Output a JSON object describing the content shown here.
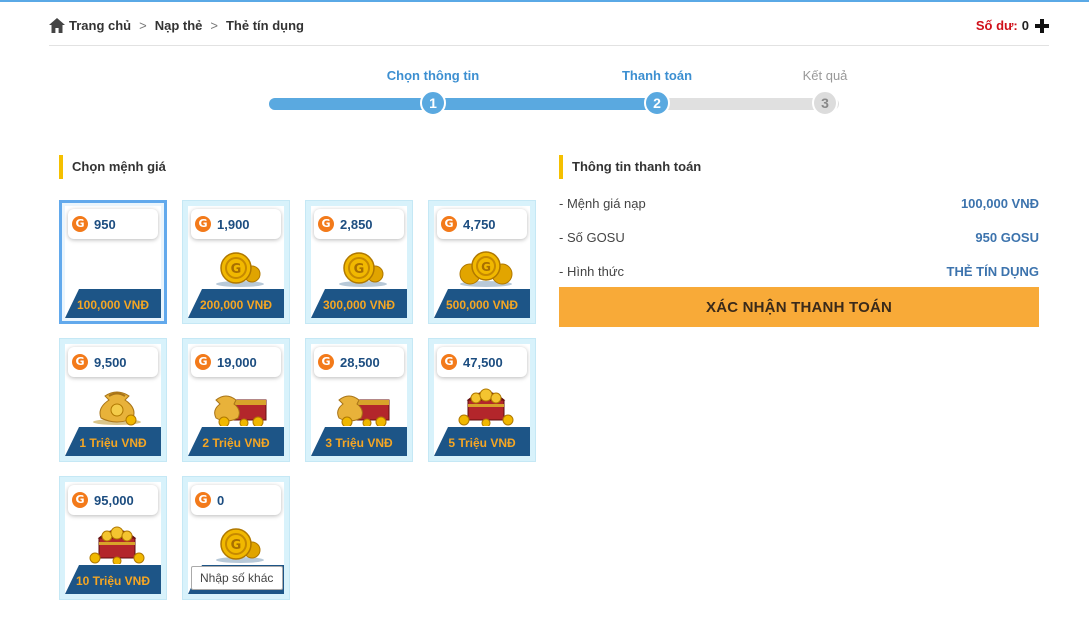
{
  "breadcrumb": {
    "items": [
      "Trang chủ",
      "Nạp thẻ",
      "Thẻ tín dụng"
    ],
    "separator": ">"
  },
  "balance": {
    "label": "Số dư:",
    "value": "0"
  },
  "stepper": {
    "steps": [
      {
        "label": "Chọn thông tin",
        "number": "1",
        "state": "done"
      },
      {
        "label": "Thanh toán",
        "number": "2",
        "state": "active"
      },
      {
        "label": "Kết quả",
        "number": "3",
        "state": "pending"
      }
    ],
    "progress_step": 2
  },
  "denominations": {
    "title": "Chọn mệnh giá",
    "selected_index": 0,
    "cards": [
      {
        "gosu": "950",
        "price": "100,000 VNĐ",
        "art": "none"
      },
      {
        "gosu": "1,900",
        "price": "200,000 VNĐ",
        "art": "coins-small"
      },
      {
        "gosu": "2,850",
        "price": "300,000 VNĐ",
        "art": "coins-small"
      },
      {
        "gosu": "4,750",
        "price": "500,000 VNĐ",
        "art": "coins-stack"
      },
      {
        "gosu": "9,500",
        "price": "1 Triệu VNĐ",
        "art": "gold-bag"
      },
      {
        "gosu": "19,000",
        "price": "2 Triệu VNĐ",
        "art": "bag-chest"
      },
      {
        "gosu": "28,500",
        "price": "3 Triệu VNĐ",
        "art": "bag-chest"
      },
      {
        "gosu": "47,500",
        "price": "5 Triệu VNĐ",
        "art": "treasure-chest"
      },
      {
        "gosu": "95,000",
        "price": "10 Triệu VNĐ",
        "art": "treasure-chest"
      }
    ],
    "custom": {
      "gosu": "0",
      "placeholder": "Nhập số khác",
      "art": "coins-small"
    }
  },
  "payment_info": {
    "title": "Thông tin thanh toán",
    "rows": [
      {
        "label": "- Mệnh giá nạp",
        "value": "100,000 VNĐ"
      },
      {
        "label": "- Số GOSU",
        "value": "950 GOSU"
      },
      {
        "label": "- Hình thức",
        "value": "THẺ TÍN DỤNG"
      }
    ],
    "confirm_label": "XÁC NHẬN THANH TOÁN"
  },
  "colors": {
    "accent_blue": "#5aa9e0",
    "balance_red": "#d0101a",
    "price_band": "#1d5587",
    "price_text": "#f5a623",
    "confirm_button": "#f8aa38",
    "section_marker": "#f5c000"
  },
  "icons": {
    "home": "home-icon",
    "add_balance": "plus-icon",
    "currency": "gosu-coin-icon"
  }
}
